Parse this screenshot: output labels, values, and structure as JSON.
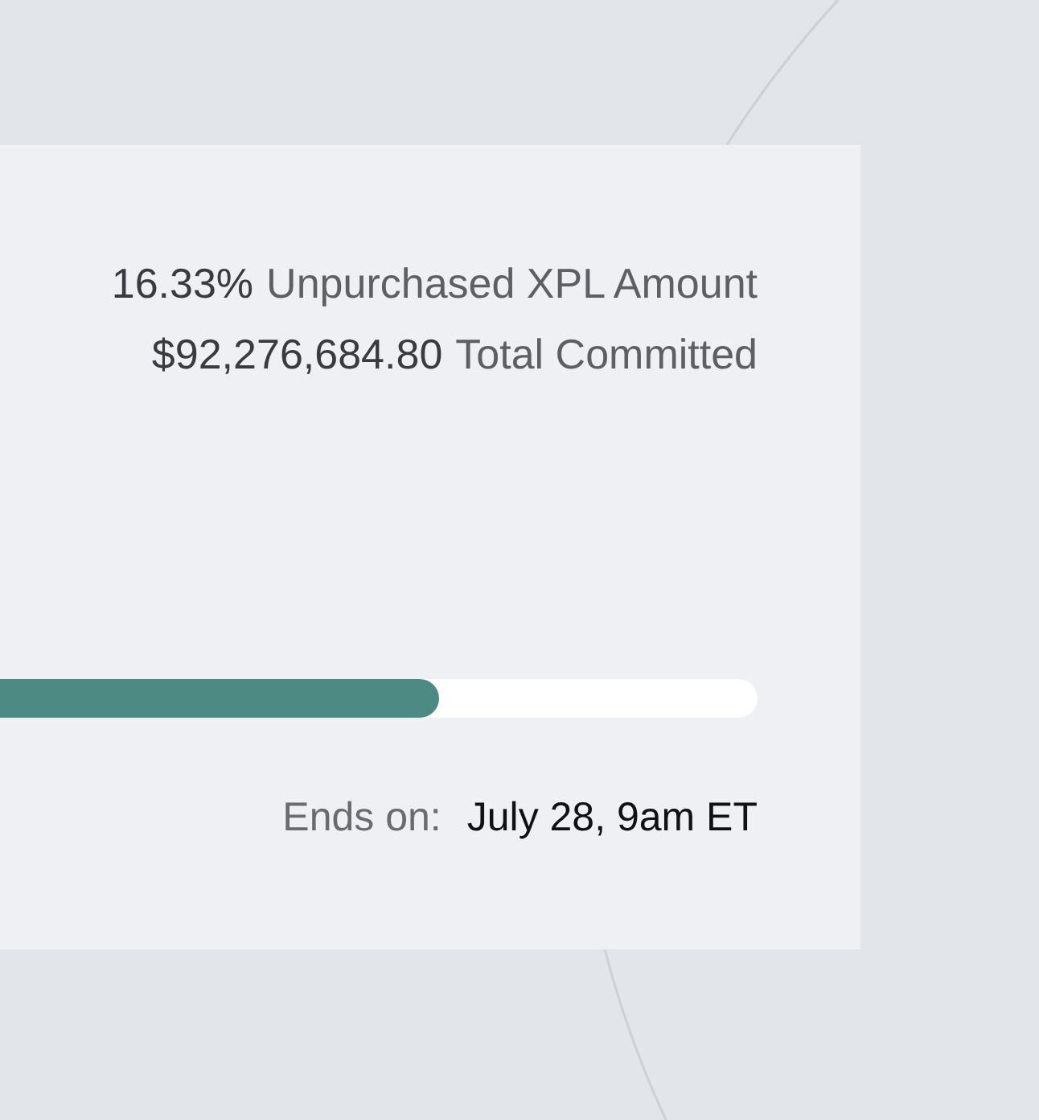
{
  "stats": [
    {
      "figure": "16.33%",
      "caption": "Unpurchased XPL Amount"
    },
    {
      "figure": "$92,276,684.80",
      "caption": "Total Committed"
    }
  ],
  "progress": {
    "level": 0.58
  },
  "end": {
    "label": "Ends on:",
    "value": "July 28, 9am ET"
  }
}
